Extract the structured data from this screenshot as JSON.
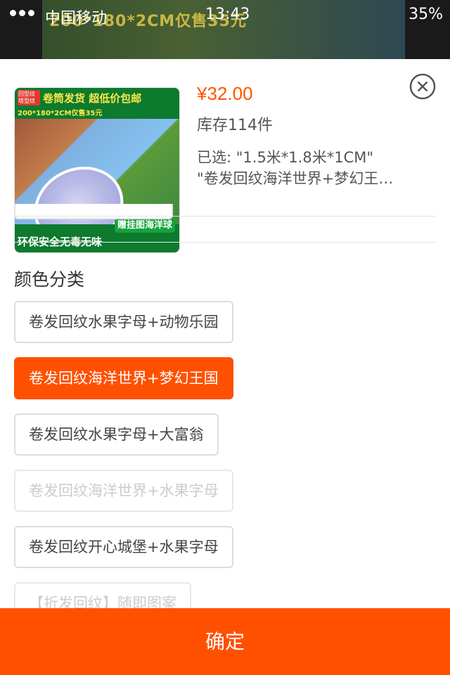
{
  "status_bar": {
    "carrier": "中国移动",
    "time": "13:43",
    "battery": "35%"
  },
  "background_banner": {
    "text": "200*180*2CM仅售35元"
  },
  "product": {
    "image": {
      "tag": "回型纹塔型纹",
      "headline": "卷筒发货 超低价包邮",
      "sub": "200*180*2CM仅售35元",
      "bottom_text": "环保安全无毒无味",
      "gift_text": "赠挂图海洋球"
    },
    "price": "¥32.00",
    "stock": "库存114件",
    "selected_line1": "已选: \"1.5米*1.8米*1CM\"",
    "selected_line2": "\"卷发回纹海洋世界+梦幻王国\""
  },
  "close_icon": "close-circle-icon",
  "color_section": {
    "title": "颜色分类",
    "options": [
      {
        "label": "卷发回纹水果字母+动物乐园",
        "state": "normal"
      },
      {
        "label": "卷发回纹海洋世界+梦幻王国",
        "state": "selected"
      },
      {
        "label": "卷发回纹水果字母+大富翁",
        "state": "normal"
      },
      {
        "label": "卷发回纹海洋世界+水果字母",
        "state": "disabled"
      },
      {
        "label": "卷发回纹开心城堡+水果字母",
        "state": "normal"
      },
      {
        "label": "【折发回纹】随即图案",
        "state": "disabled"
      }
    ]
  },
  "confirm_button": "确定",
  "colors": {
    "accent": "#ff5000",
    "price": "#ff5500",
    "border": "#dddddd"
  }
}
